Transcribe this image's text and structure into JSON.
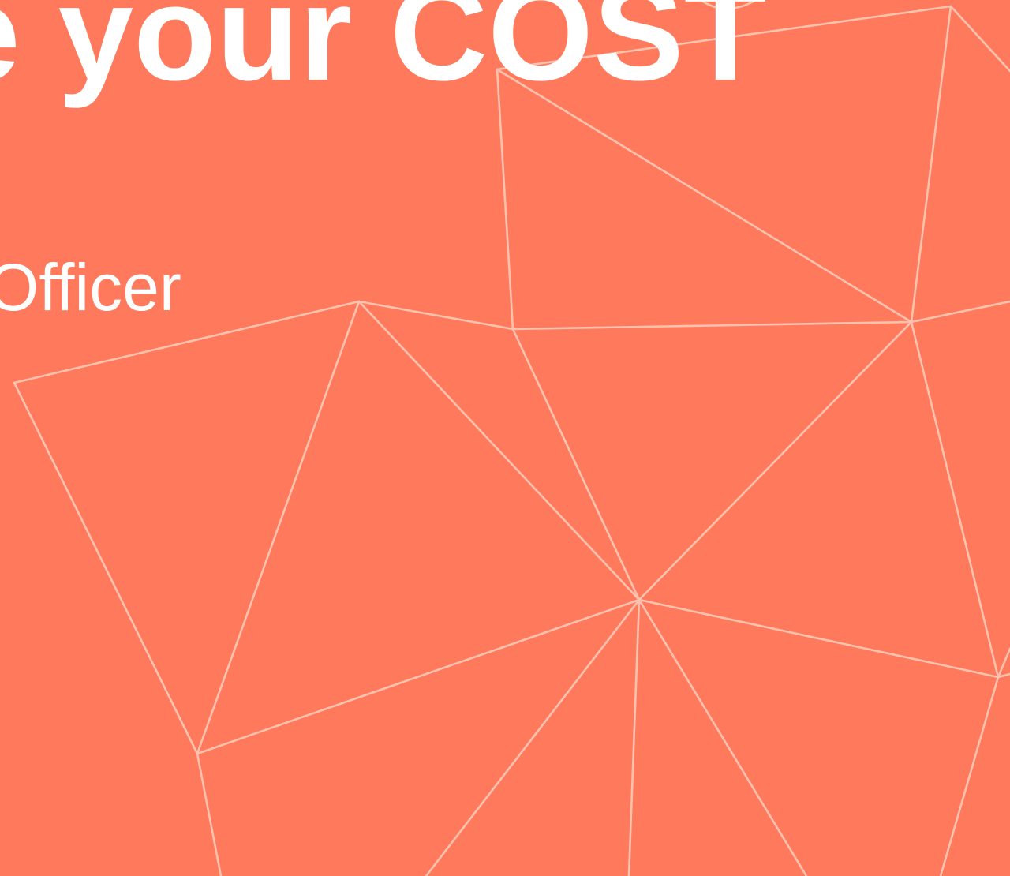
{
  "slide": {
    "headline": "e your COST",
    "subtitle": "Officer",
    "colors": {
      "background": "#FF7A5C",
      "text": "#FFFFFF",
      "mesh_lines": "#FFC2AE"
    }
  }
}
